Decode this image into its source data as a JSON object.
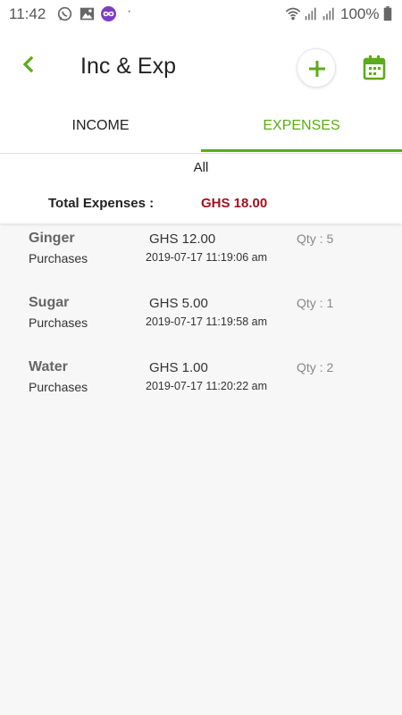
{
  "status_bar": {
    "time": "11:42",
    "battery": "100%",
    "icons": [
      "whatsapp-icon",
      "gallery-icon",
      "infinity-icon",
      "wifi-icon",
      "signal-icon",
      "battery-icon"
    ]
  },
  "header": {
    "title": "Inc & Exp",
    "back_icon": "chevron-left-icon",
    "add_icon": "plus-icon",
    "calendar_icon": "calendar-icon"
  },
  "tabs": [
    {
      "label": "INCOME",
      "active": false
    },
    {
      "label": "EXPENSES",
      "active": true
    }
  ],
  "summary": {
    "filter": "All",
    "total_label": "Total Expenses :",
    "total_value": "GHS  18.00"
  },
  "items": [
    {
      "name": "Ginger",
      "type": "Purchases",
      "amount": "GHS  12.00",
      "date": "2019-07-17 11:19:06 am",
      "qty": "Qty : 5"
    },
    {
      "name": "Sugar",
      "type": "Purchases",
      "amount": "GHS  5.00",
      "date": "2019-07-17 11:19:58 am",
      "qty": "Qty : 1"
    },
    {
      "name": "Water",
      "type": "Purchases",
      "amount": "GHS  1.00",
      "date": "2019-07-17 11:20:22 am",
      "qty": "Qty : 2"
    }
  ],
  "colors": {
    "accent": "#5aac1a",
    "total": "#a0121e",
    "background": "#f7f7f7"
  }
}
